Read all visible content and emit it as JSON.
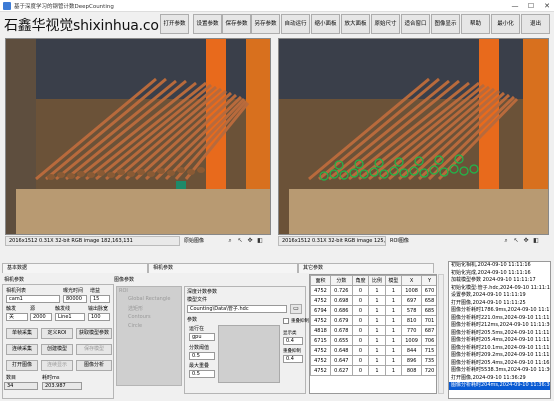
{
  "window": {
    "title": "基于深度学习的钢管计数DeepCounting",
    "brand": "石鑫华视觉shixinhua.com",
    "controls": [
      "—",
      "☐",
      "✕"
    ]
  },
  "toolbar": [
    "打开参数",
    "设置参数",
    "保存参数",
    "另存参数",
    "自动运行",
    "缩小面板",
    "放大面板",
    "原始尺寸",
    "适合窗口",
    "图像显示",
    "帮助",
    "最小化",
    "退出"
  ],
  "left_view": {
    "status": "2016x1512 0.31X 32-bit RGB image 182,163,131",
    "label": "原始图像"
  },
  "right_view": {
    "status": "2016x1512 0.31X 32-bit RGB image 125,89,31",
    "label": "ROI图像"
  },
  "tabs": {
    "basic": "基本数据",
    "camera": "相机参数",
    "image": "图像参数",
    "other": "其它参数"
  },
  "camera": {
    "list_label": "相机列表",
    "list_value": "cam1",
    "exposure_label": "曝光时间",
    "exposure_value": "80000",
    "gain_label": "增益",
    "gain_value": "15",
    "trigger_label": "触发",
    "trigger_value": "关",
    "trigger_src_label": "源",
    "trigger_src_value": "2000",
    "trigger_mode_label": "触发线",
    "trigger_mode_value": "Line1",
    "output_label": "输出脉宽",
    "output_value": "100",
    "buttons": [
      "单帧采集",
      "定义ROI",
      "获取模型参数",
      "连续采集",
      "创建模型",
      "保存模型",
      "打开图像",
      "连续显示",
      "图像分析"
    ],
    "count_label": "数目",
    "count_value": "34",
    "time_label": "耗时ms",
    "time_value": "203.987"
  },
  "roi_box": {
    "title": "ROI",
    "items": [
      "Global Rectangle",
      "选矩形",
      "Contours",
      "Circle"
    ]
  },
  "model": {
    "title": "深度计数参数",
    "file_label": "模型文件",
    "file_value": "Counting\\Data\\管子.hdc",
    "params_label": "参数",
    "run_label": "运行在",
    "run_value": "gpu",
    "score_label": "分数阈值",
    "score_value": "0.5",
    "max_label": "最大重叠",
    "max_value": "0.5",
    "check1": "重叠抑制",
    "check2": "显示类",
    "check2_value": "0.4",
    "check3": "重叠抑制",
    "check3_value": "0.4"
  },
  "table": {
    "headers": [
      "面积",
      "分数",
      "角度",
      "比例",
      "模型",
      "X",
      "Y"
    ],
    "rows": [
      [
        "4752",
        "0.726",
        "0",
        "1",
        "1",
        "1008",
        "670"
      ],
      [
        "4752",
        "0.698",
        "0",
        "1",
        "1",
        "697",
        "658"
      ],
      [
        "6794",
        "0.686",
        "0",
        "1",
        "1",
        "578",
        "685"
      ],
      [
        "4752",
        "0.679",
        "0",
        "1",
        "1",
        "810",
        "701"
      ],
      [
        "4818",
        "0.678",
        "0",
        "1",
        "1",
        "770",
        "687"
      ],
      [
        "6715",
        "0.655",
        "0",
        "1",
        "1",
        "1009",
        "706"
      ],
      [
        "4752",
        "0.648",
        "0",
        "1",
        "1",
        "844",
        "715"
      ],
      [
        "4752",
        "0.647",
        "0",
        "1",
        "1",
        "896",
        "735"
      ],
      [
        "4752",
        "0.627",
        "0",
        "1",
        "1",
        "808",
        "720"
      ]
    ]
  },
  "log": [
    "初始化相机,2024-09-10 11:11:16",
    "初始化完成,2024-09-10 11:11:16",
    "加载模型参数 2024-09-10 11:11:17",
    "初始化模型:管子.hdc,2024-09-10 11:11:19",
    "设置参数,2024-09-10 11:11:19",
    "打开图像,2024-09-10 11:11:25",
    "图像分析耗时1786.9ms,2024-09-10 11:11:25",
    "图像分析耗时221.0ms,2024-09-10 11:11:35",
    "图像分析耗时212ms,2024-09-10 11:11:36",
    "图像分析耗时205.5ms,2024-09-10 11:11:39",
    "图像分析耗时205.4ms,2024-09-10 11:11:40",
    "图像分析耗时210.1ms,2024-09-10 11:11:41",
    "图像分析耗时209.2ms,2024-09-10 11:11:43",
    "图像分析耗时205.4ms,2024-09-10 11:16:28",
    "图像分析耗时5538.3ms,2024-09-10 11:36:29",
    "打开图像,2024-09-10 11:36:29",
    "图像分析耗时204ms,2024-09-10 11:36:30"
  ]
}
